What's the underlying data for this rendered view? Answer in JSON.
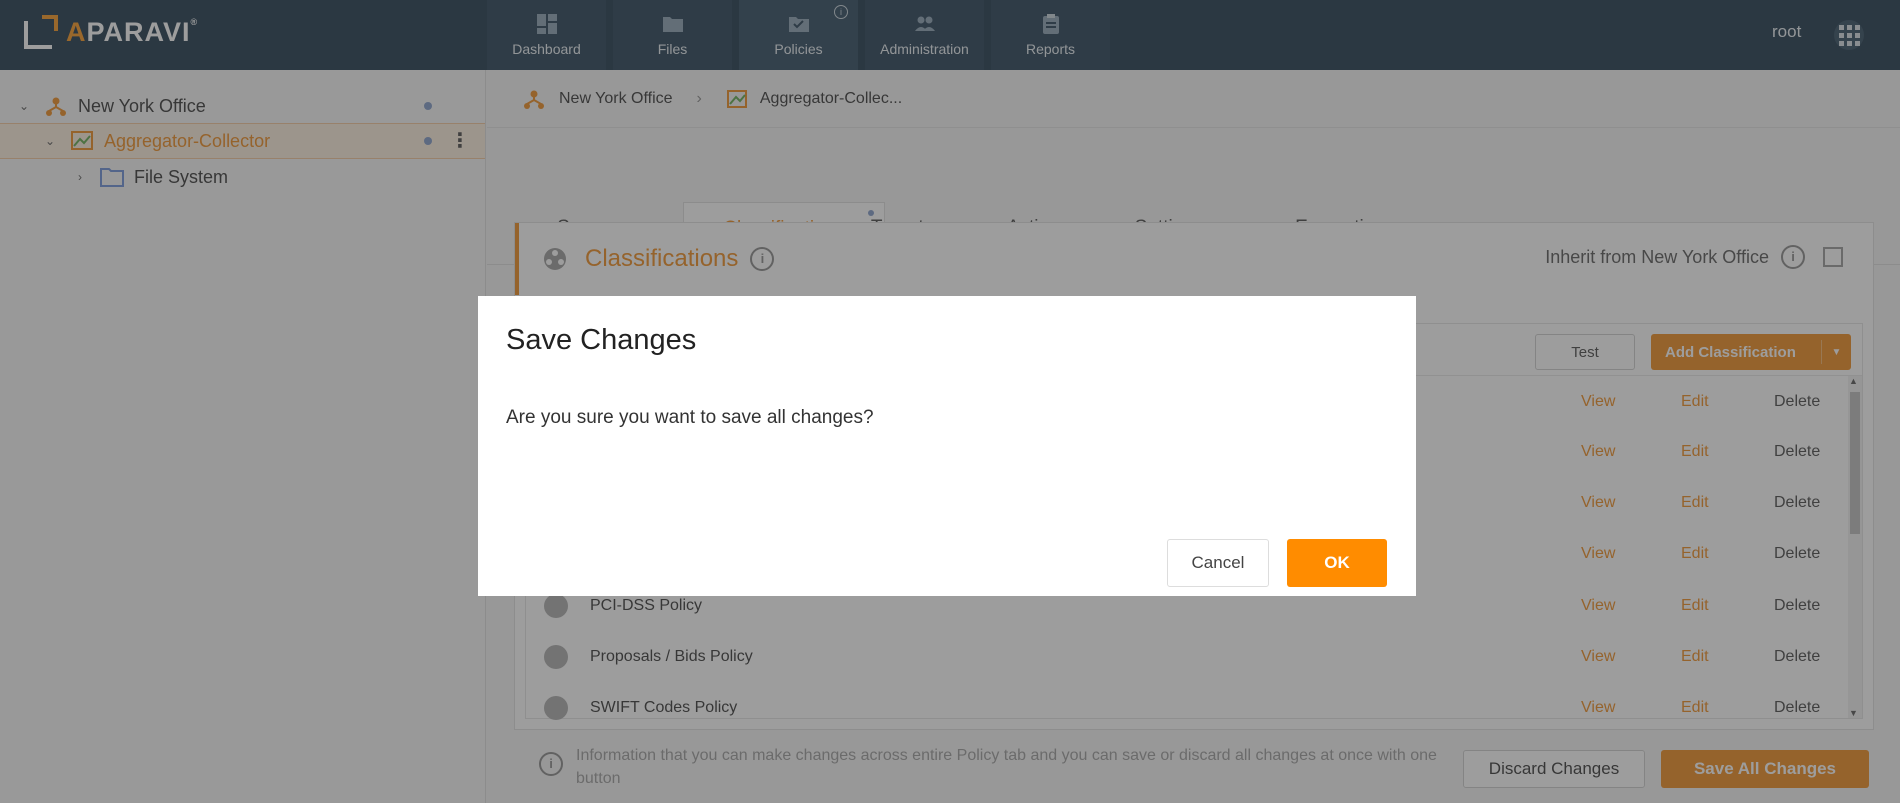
{
  "app": {
    "logo_text": "APARAVI",
    "user": "root"
  },
  "nav": {
    "items": [
      {
        "label": "Dashboard",
        "icon": "dashboard-icon"
      },
      {
        "label": "Files",
        "icon": "folder-icon"
      },
      {
        "label": "Policies",
        "icon": "policies-icon",
        "active": true
      },
      {
        "label": "Administration",
        "icon": "people-icon"
      },
      {
        "label": "Reports",
        "icon": "clipboard-icon"
      }
    ]
  },
  "tree": {
    "items": [
      {
        "label": "New York Office",
        "icon": "network-node-icon"
      },
      {
        "label": "Aggregator-Collector",
        "icon": "aggregator-icon",
        "selected": true
      },
      {
        "label": "File System",
        "icon": "folder-icon"
      }
    ]
  },
  "breadcrumb": {
    "items": [
      "New York Office",
      "Aggregator-Collec..."
    ]
  },
  "tabs": {
    "items": [
      "Sources",
      "Classifications",
      "Targets",
      "Actions",
      "Settings",
      "Encryption"
    ],
    "active": "Classifications"
  },
  "panel": {
    "title": "Classifications",
    "inherit_label": "Inherit from New York Office",
    "test_label": "Test",
    "add_label": "Add Classification",
    "rows": [
      {
        "name": "",
        "view": "View",
        "edit": "Edit",
        "delete": "Delete"
      },
      {
        "name": "",
        "view": "View",
        "edit": "Edit",
        "delete": "Delete"
      },
      {
        "name": "",
        "view": "View",
        "edit": "Edit",
        "delete": "Delete"
      },
      {
        "name": "",
        "view": "View",
        "edit": "Edit",
        "delete": "Delete"
      },
      {
        "name": "PCI-DSS Policy",
        "view": "View",
        "edit": "Edit",
        "delete": "Delete"
      },
      {
        "name": "Proposals / Bids Policy",
        "view": "View",
        "edit": "Edit",
        "delete": "Delete"
      },
      {
        "name": "SWIFT Codes Policy",
        "view": "View",
        "edit": "Edit",
        "delete": "Delete"
      }
    ]
  },
  "footer": {
    "info_text": "Information that you can make changes across entire Policy tab and you can save or discard all changes at once with one button",
    "discard_label": "Discard Changes",
    "save_all_label": "Save All Changes"
  },
  "modal": {
    "title": "Save Changes",
    "message": "Are you sure you want to save all changes?",
    "cancel_label": "Cancel",
    "ok_label": "OK"
  },
  "colors": {
    "accent": "#ef8a1d",
    "topbar": "#1b3448",
    "ok_button": "#ff8c00"
  }
}
